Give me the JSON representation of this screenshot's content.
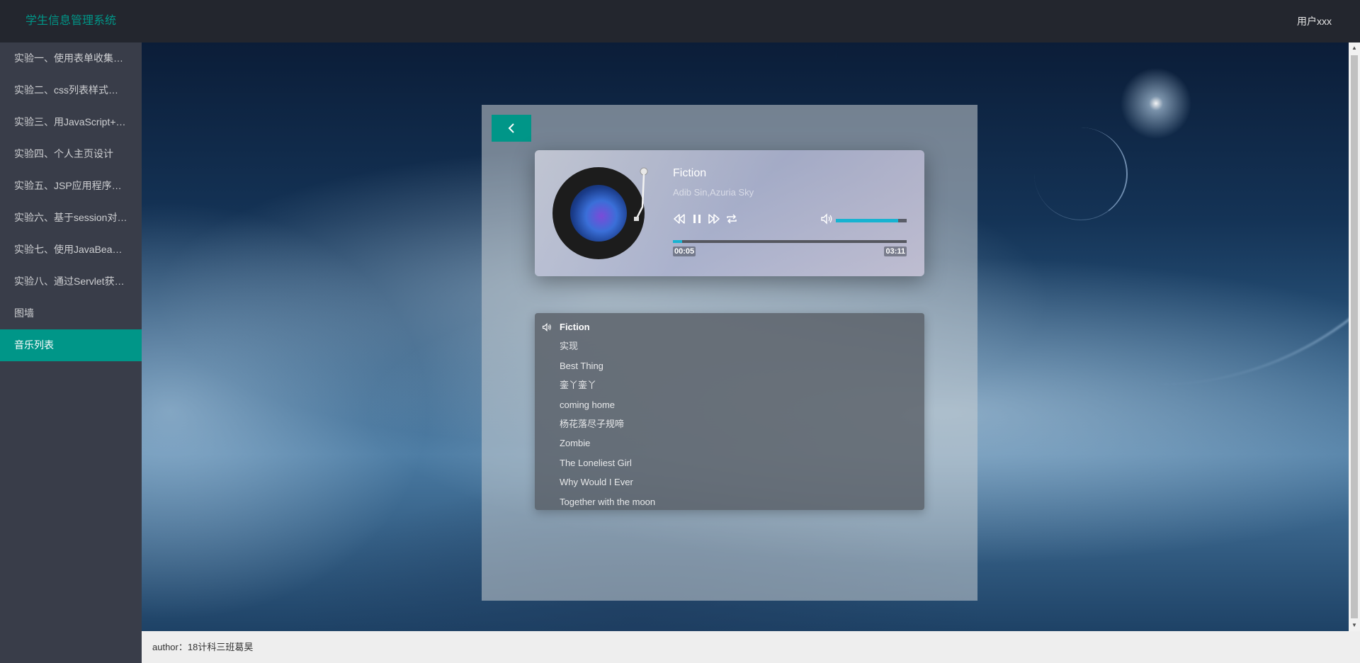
{
  "header": {
    "title": "学生信息管理系统",
    "user": "用户xxx"
  },
  "sidebar": {
    "items": [
      {
        "label": "实验一、使用表单收集…",
        "active": false
      },
      {
        "label": "实验二、css列表样式…",
        "active": false
      },
      {
        "label": "实验三、用JavaScript+…",
        "active": false
      },
      {
        "label": "实验四、个人主页设计",
        "active": false
      },
      {
        "label": "实验五、JSP应用程序…",
        "active": false
      },
      {
        "label": "实验六、基于session对…",
        "active": false
      },
      {
        "label": "实验七、使用JavaBea…",
        "active": false
      },
      {
        "label": "实验八、通过Servlet获…",
        "active": false
      },
      {
        "label": "图墙",
        "active": false
      },
      {
        "label": "音乐列表",
        "active": true
      }
    ]
  },
  "player": {
    "title": "Fiction",
    "artist": "Adib Sin,Azuria Sky",
    "current_time": "00:05",
    "total_time": "03:11",
    "progress_fraction": 0.04,
    "volume_fraction": 0.88,
    "accent_color": "#17b3d1",
    "controls": [
      "rewind-icon",
      "pause-icon",
      "fast-forward-icon",
      "repeat-icon",
      "volume-icon"
    ]
  },
  "playlist": {
    "tracks": [
      {
        "title": "Fiction",
        "playing": true
      },
      {
        "title": "实现",
        "playing": false
      },
      {
        "title": "Best Thing",
        "playing": false
      },
      {
        "title": "銮丫銮丫",
        "playing": false
      },
      {
        "title": "coming home",
        "playing": false
      },
      {
        "title": "杨花落尽子规啼",
        "playing": false
      },
      {
        "title": "Zombie",
        "playing": false
      },
      {
        "title": "The Loneliest Girl",
        "playing": false
      },
      {
        "title": "Why Would I Ever",
        "playing": false
      },
      {
        "title": "Together with the moon",
        "playing": false
      }
    ]
  },
  "footer": {
    "text": "author：18计科三班葛昊"
  },
  "colors": {
    "brand": "#009688",
    "header_bg": "#23262e",
    "sidebar_bg": "#393d49"
  }
}
